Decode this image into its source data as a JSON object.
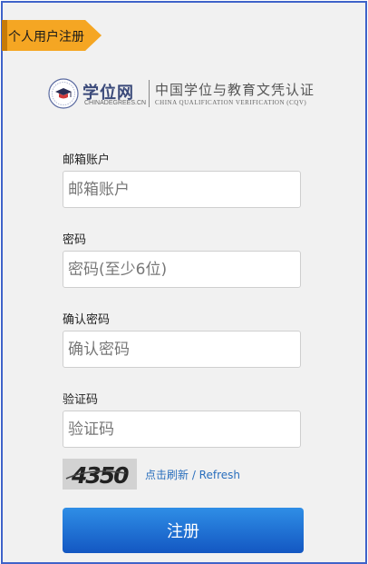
{
  "ribbon": {
    "label": "个人用户注册"
  },
  "logo": {
    "brand": "学位网",
    "domain": "CHINADEGREES.CN",
    "title_cn": "中国学位与教育文凭认证",
    "title_en": "CHINA QUALIFICATION VERIFICATION (CQV)"
  },
  "form": {
    "email": {
      "label": "邮箱账户",
      "placeholder": "邮箱账户",
      "value": ""
    },
    "password": {
      "label": "密码",
      "placeholder": "密码(至少6位)",
      "value": ""
    },
    "confirm": {
      "label": "确认密码",
      "placeholder": "确认密码",
      "value": ""
    },
    "captcha": {
      "label": "验证码",
      "placeholder": "验证码",
      "value": "",
      "image_text": "4350"
    },
    "refresh_label": "点击刷新 / Refresh",
    "submit_label": "注册"
  },
  "colors": {
    "frame_border": "#3f63c9",
    "ribbon": "#f5a623",
    "button": "#1e6fd6",
    "link": "#2a6fbd"
  }
}
